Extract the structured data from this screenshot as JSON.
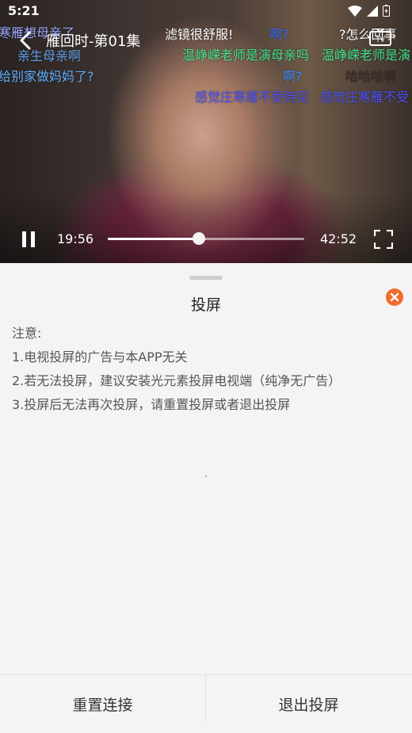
{
  "status_bar": {
    "time": "5:21"
  },
  "player": {
    "title": "雁回时-第01集",
    "current_time": "19:56",
    "total_time": "42:52",
    "progress_fraction": 0.465,
    "tv_icon_text": "TV"
  },
  "danmaku": [
    {
      "text": "寒雁想母亲了",
      "color": "#9aa8ff"
    },
    {
      "text": "滤镜很舒服!",
      "color": "#ffffff"
    },
    {
      "text": "啊?",
      "color": "#3a6cff"
    },
    {
      "text": "?怎么回事",
      "color": "#ffffff"
    },
    {
      "text": "亲生母亲啊",
      "color": "#5fa0e8"
    },
    {
      "text": "温峥嵘老师是演母亲吗",
      "color": "#3fe08a"
    },
    {
      "text": "温峥嵘老师是演",
      "color": "#3fe08a"
    },
    {
      "text": "给别家做妈妈了?",
      "color": "#5fb0ff"
    },
    {
      "text": "啊?",
      "color": "#3a8cff"
    },
    {
      "text": "哈哈哈啊",
      "color": "#3a2a28"
    },
    {
      "text": "感觉庄寒雁不受待见",
      "color": "#4a52ff"
    },
    {
      "text": "感觉庄寒雁不受",
      "color": "#4a52ff"
    }
  ],
  "sheet": {
    "title": "投屏",
    "notice": [
      "注意:",
      "1.电视投屏的广告与本APP无关",
      "2.若无法投屏，建议安装光元素投屏电视端（纯净无广告）",
      "3.投屏后无法再次投屏，请重置投屏或者退出投屏"
    ],
    "reset_label": "重置连接",
    "exit_label": "退出投屏"
  },
  "colors": {
    "accent_close": "#f26b2f"
  },
  "icons": [
    "wifi-icon",
    "signal-icon",
    "battery-icon",
    "back-arrow-icon",
    "tv-cast-icon",
    "pause-icon",
    "fullscreen-icon",
    "close-icon"
  ]
}
